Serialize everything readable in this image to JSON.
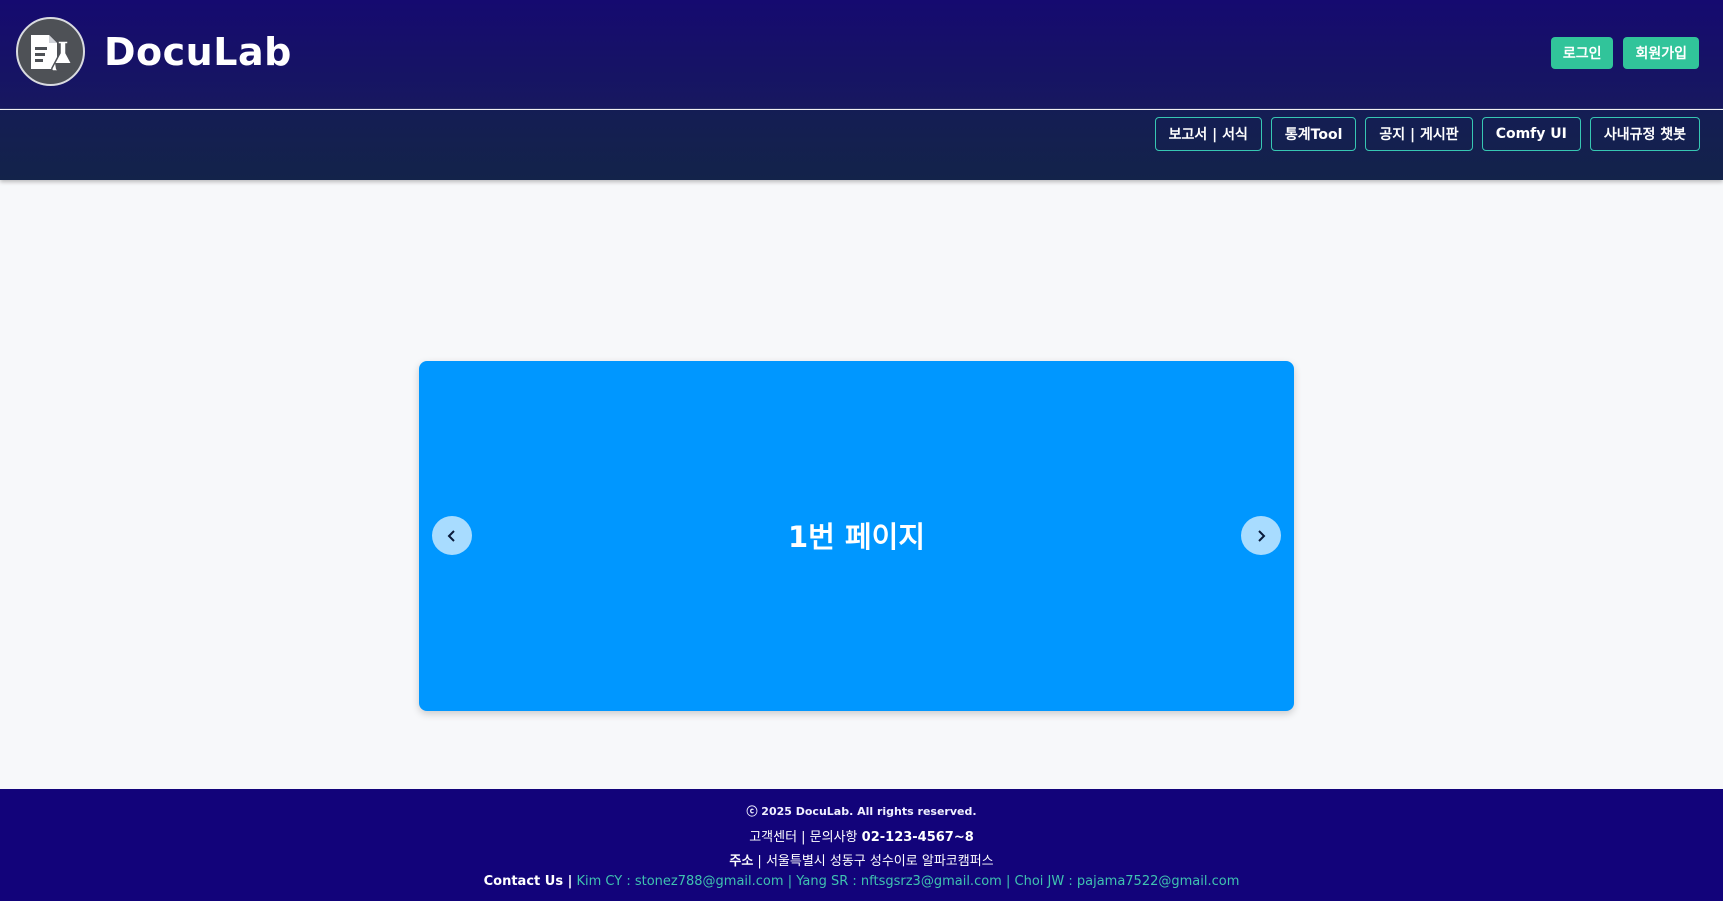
{
  "header": {
    "brand": "DocuLab",
    "logo_icon": "document-flask-icon",
    "auth": {
      "login": "로그인",
      "signup": "회원가입",
      "accent_color": "#31c49a"
    }
  },
  "nav": {
    "items": [
      {
        "label": "보고서 | 서식"
      },
      {
        "label": "통계Tool"
      },
      {
        "label": "공지 | 게시판"
      },
      {
        "label": "Comfy UI"
      },
      {
        "label": "사내규정 챗봇"
      }
    ],
    "border_color": "#37c7b3"
  },
  "carousel": {
    "slide_title": "1번 페이지",
    "prev_symbol": "‹",
    "next_symbol": "›",
    "slide_color": "#0097ff"
  },
  "footer": {
    "copyright": "ⓒ 2025 DocuLab. All rights reserved.",
    "support_label": "고객센터 | 문의사항 ",
    "support_phone": "02-123-4567~8",
    "address_label": "주소",
    "address_text": " | 서울특별시 성동구 성수이로 알파코캠퍼스",
    "contact_label": "Contact Us |",
    "contacts": [
      {
        "text": "Kim CY : stonez788@gmail.com"
      },
      {
        "text": "Yang SR : nftsgsrz3@gmail.com"
      },
      {
        "text": "Choi JW : pajama7522@gmail.com"
      }
    ],
    "contact_separator": "|"
  }
}
